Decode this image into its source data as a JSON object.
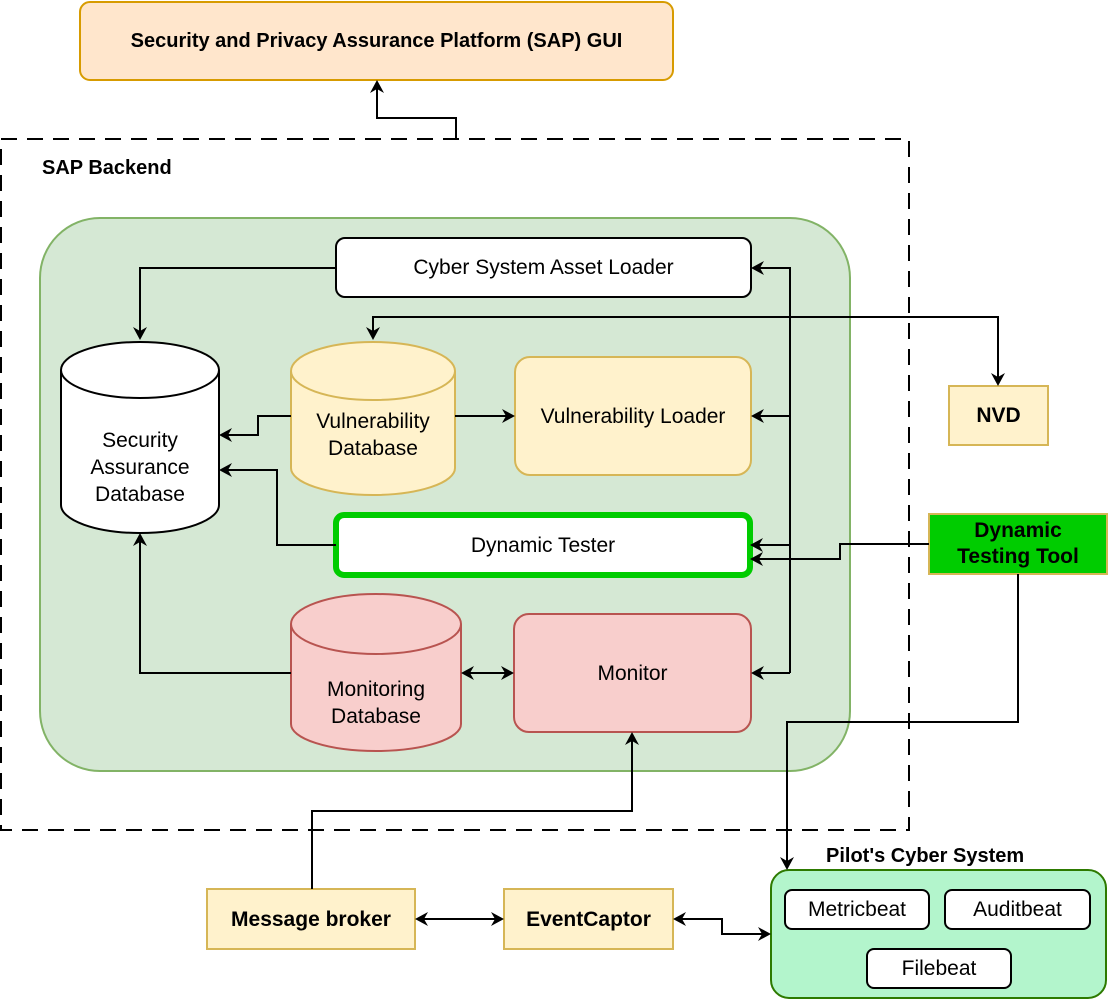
{
  "title": "Security and Privacy Assurance Platform (SAP) GUI",
  "backend": {
    "label": "SAP Backend",
    "components": {
      "asset_loader": "Cyber System Asset Loader",
      "security_db": "Security\nAssurance\nDatabase",
      "vulnerability_db": "Vulnerability\nDatabase",
      "vulnerability_loader": "Vulnerability Loader",
      "dynamic_tester": "Dynamic Tester",
      "monitoring_db": "Monitoring\nDatabase",
      "monitor": "Monitor"
    }
  },
  "external": {
    "nvd": "NVD",
    "dynamic_testing_tool": "Dynamic\nTesting Tool",
    "message_broker": "Message broker",
    "event_captor": "EventCaptor"
  },
  "pilot_system": {
    "label": "Pilot's Cyber System",
    "agents": [
      "Metricbeat",
      "Auditbeat",
      "Filebeat"
    ]
  },
  "colors": {
    "gui_fill": "#ffe6cc",
    "gui_stroke": "#d79b00",
    "backend_fill": "#d5e8d4",
    "backend_stroke": "#82b366",
    "yellow_fill": "#fff2cc",
    "yellow_stroke": "#d6b656",
    "red_fill": "#f8cecc",
    "red_stroke": "#b85450",
    "tester_stroke": "#00cc00",
    "tool_fill": "#00cc00",
    "pilot_fill": "#b3f5cc",
    "pilot_stroke": "#2d7a00"
  }
}
